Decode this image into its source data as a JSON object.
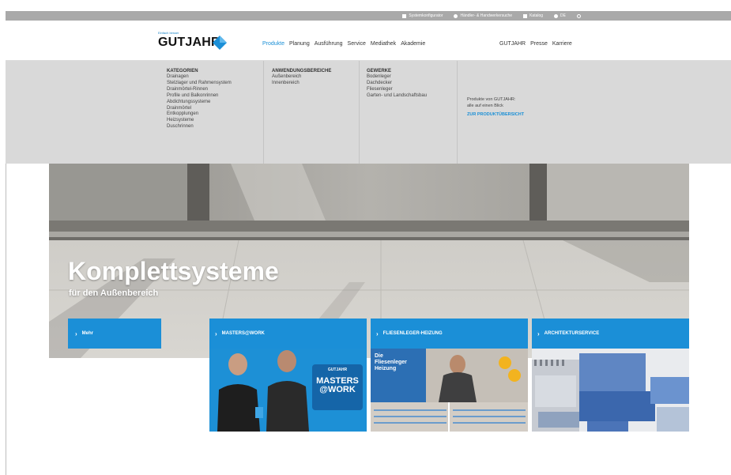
{
  "utility_bar": {
    "items": [
      {
        "label": "Systemkonfigurator",
        "icon": "configurator-icon"
      },
      {
        "label": "Händler- & Handwerkersuche",
        "icon": "location-icon"
      },
      {
        "label": "Katalog",
        "icon": "catalog-icon"
      },
      {
        "label": "DE",
        "icon": "globe-icon"
      }
    ],
    "search_icon": "search-icon"
  },
  "header": {
    "logo_tagline": "Einfach besser",
    "logo_word": "GUTJAHR",
    "nav": [
      "Produkte",
      "Planung",
      "Ausführung",
      "Service",
      "Mediathek",
      "Akademie"
    ],
    "active_nav": "Produkte",
    "side_nav": [
      "GUTJAHR",
      "Presse",
      "Karriere"
    ]
  },
  "mega_menu": {
    "kategorien": {
      "heading": "KATEGORIEN",
      "items": [
        "Drainagen",
        "Stelzlager und Rahmensystem",
        "Drainmörtel-Rinnen",
        "Profile und Balkonrinnen",
        "Abdichtungssysteme",
        "Drainmörtel",
        "Entkopplungen",
        "Heizsysteme",
        "Duschrinnen"
      ]
    },
    "anwendungsbereiche": {
      "heading": "ANWENDUNGSBEREICHE",
      "items": [
        "Außenbereich",
        "Innenbereich"
      ]
    },
    "gewerke": {
      "heading": "GEWERKE",
      "items": [
        "Bodenleger",
        "Dachdecker",
        "Fliesenleger",
        "Garten- und Landschaftsbau"
      ]
    },
    "promo": {
      "line1": "Produkte von GUTJAHR:",
      "line2": "alle auf einen Blick",
      "link": "ZUR PRODUKTÜBERSICHT"
    }
  },
  "hero": {
    "title": "Komplettsysteme",
    "subtitle": "für den Außenbereich",
    "button": "Mehr"
  },
  "cards": [
    {
      "label": "MASTERS@WORK",
      "badge_logo": "GUTJAHR",
      "badge_l1": "MASTERS",
      "badge_l2": "@WORK"
    },
    {
      "label": "FLIESENLEGER-HEIZUNG",
      "inset_l1": "Die",
      "inset_l2": "Fliesenleger",
      "inset_l3": "Heizung"
    },
    {
      "label": "ARCHITEKTURSERVICE"
    }
  ],
  "colors": {
    "accent": "#1b8fd7",
    "utility_bar": "#a9a9a9",
    "mega_bg": "#d9d9d9"
  }
}
